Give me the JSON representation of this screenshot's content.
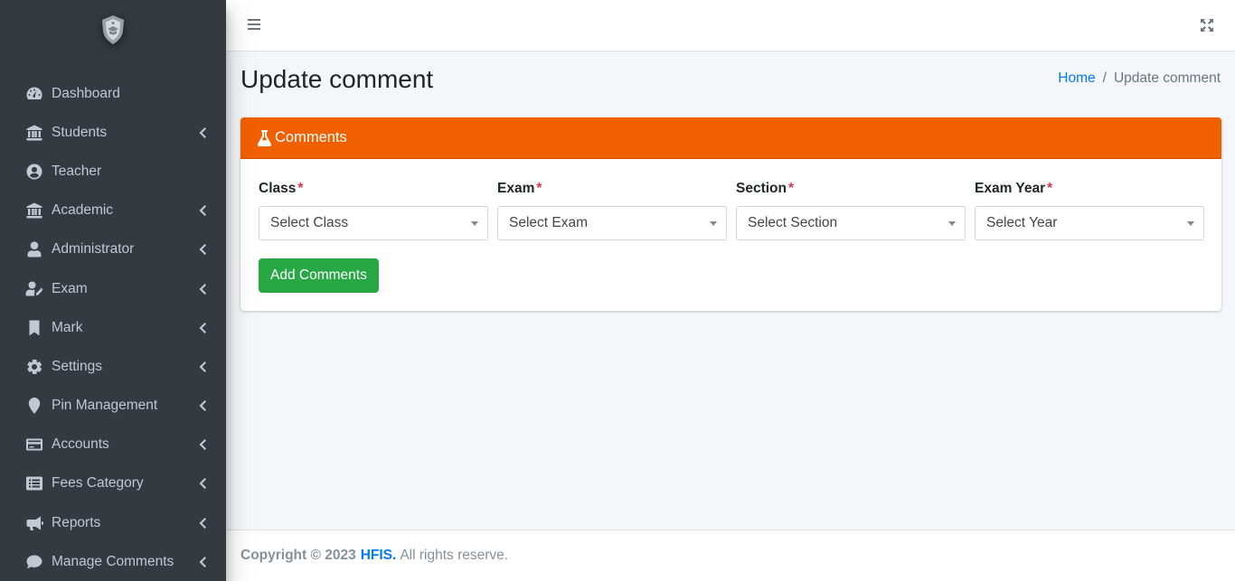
{
  "sidebar": {
    "items": [
      {
        "label": "Dashboard",
        "icon": "tachometer-icon",
        "has_children": false
      },
      {
        "label": "Students",
        "icon": "university-icon",
        "has_children": true
      },
      {
        "label": "Teacher",
        "icon": "user-circle-icon",
        "has_children": false
      },
      {
        "label": "Academic",
        "icon": "university-icon",
        "has_children": true
      },
      {
        "label": "Administrator",
        "icon": "user-icon",
        "has_children": true
      },
      {
        "label": "Exam",
        "icon": "user-edit-icon",
        "has_children": true
      },
      {
        "label": "Mark",
        "icon": "bookmark-icon",
        "has_children": true
      },
      {
        "label": "Settings",
        "icon": "gear-icon",
        "has_children": true
      },
      {
        "label": "Pin Management",
        "icon": "map-pin-icon",
        "has_children": true
      },
      {
        "label": "Accounts",
        "icon": "credit-card-icon",
        "has_children": true
      },
      {
        "label": "Fees Category",
        "icon": "list-alt-icon",
        "has_children": true
      },
      {
        "label": "Reports",
        "icon": "bullhorn-icon",
        "has_children": true
      },
      {
        "label": "Manage Comments",
        "icon": "comment-icon",
        "has_children": true
      }
    ]
  },
  "header": {
    "title": "Update comment",
    "breadcrumb": {
      "home": "Home",
      "separator": "/",
      "current": "Update comment"
    }
  },
  "card": {
    "title": "Comments",
    "icon": "flask-icon",
    "fields": [
      {
        "label": "Class",
        "required": "*",
        "placeholder": "Select Class"
      },
      {
        "label": "Exam",
        "required": "*",
        "placeholder": "Select Exam"
      },
      {
        "label": "Section",
        "required": "*",
        "placeholder": "Select Section"
      },
      {
        "label": "Exam Year",
        "required": "*",
        "placeholder": "Select Year"
      }
    ],
    "submit_label": "Add Comments"
  },
  "footer": {
    "copyright": "Copyright © 2023",
    "brand": "HFIS.",
    "rights": "All rights reserve."
  },
  "colors": {
    "sidebar_bg": "#343a40",
    "card_header": "#f06000",
    "button": "#28a745",
    "link": "#007bff",
    "required": "#dc3545"
  }
}
